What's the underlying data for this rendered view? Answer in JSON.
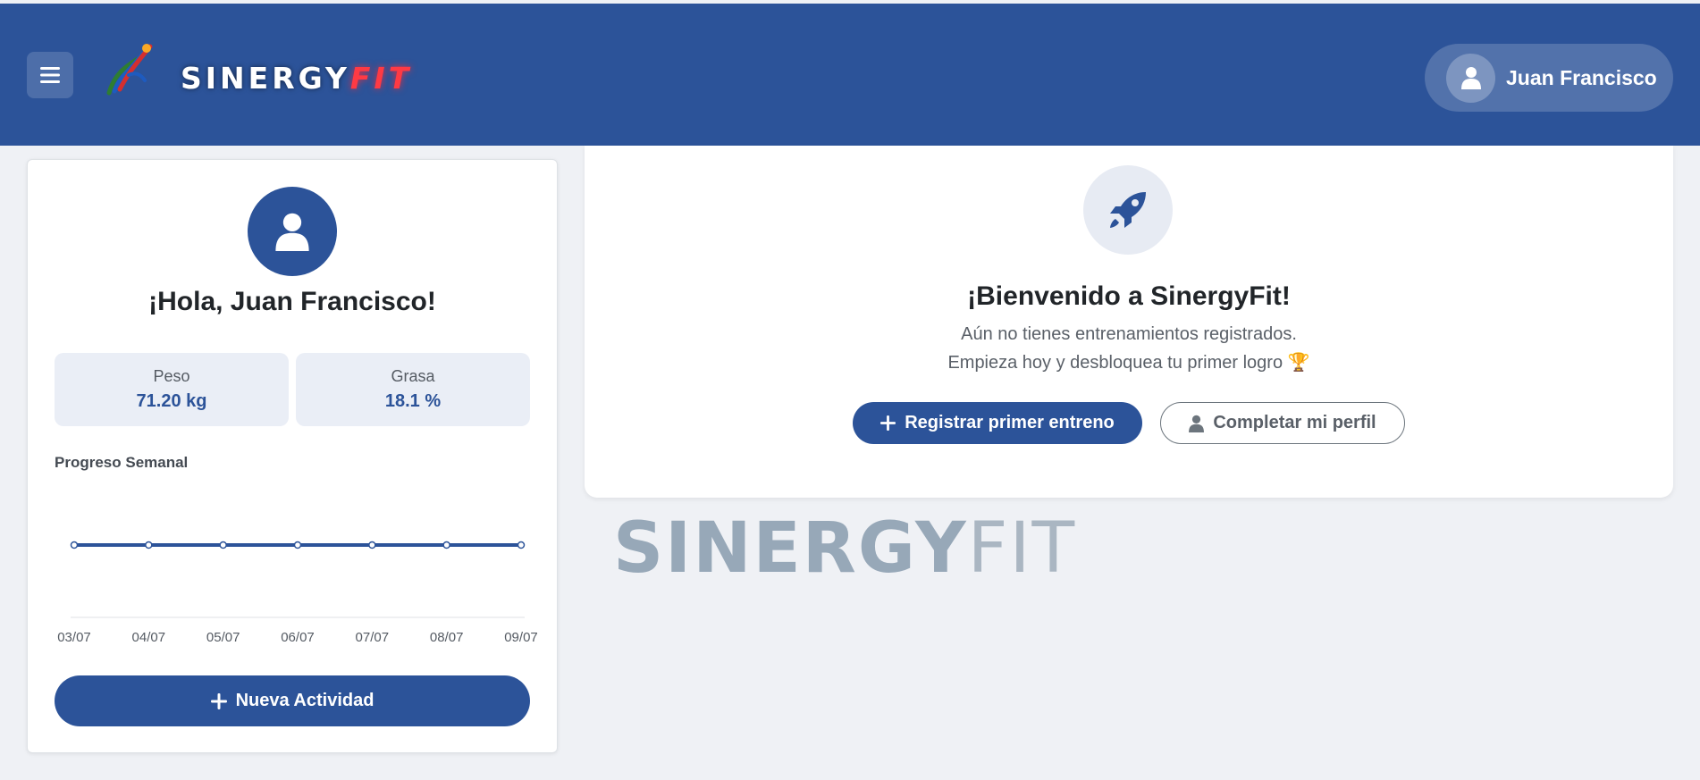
{
  "header": {
    "brand_main": "SINERGY",
    "brand_accent": "FIT",
    "user_name": "Juan Francisco"
  },
  "profile": {
    "greeting": "¡Hola, Juan Francisco!",
    "stats": [
      {
        "label": "Peso",
        "value": "71.20 kg"
      },
      {
        "label": "Grasa",
        "value": "18.1 %"
      }
    ],
    "chart_title": "Progreso Semanal",
    "new_activity_label": "Nueva Actividad"
  },
  "chart_data": {
    "type": "line",
    "title": "Progreso Semanal",
    "categories": [
      "03/07",
      "04/07",
      "05/07",
      "06/07",
      "07/07",
      "08/07",
      "09/07"
    ],
    "series": [
      {
        "values": [
          0,
          0,
          0,
          0,
          0,
          0,
          0
        ]
      }
    ],
    "xlabel": "",
    "ylabel": "",
    "grid": false,
    "colors": [
      "#2c5399"
    ]
  },
  "welcome": {
    "title": "¡Bienvenido a SinergyFit!",
    "line1": "Aún no tienes entrenamientos registrados.",
    "line2": "Empieza hoy y desbloquea tu primer logro 🏆",
    "primary_button": "Registrar primer entreno",
    "secondary_button": "Completar mi perfil"
  },
  "watermark": {
    "main": "SINERGY",
    "accent": "FIT"
  },
  "colors": {
    "brand": "#2c5399",
    "accent": "#ff3a44",
    "background": "#eff1f5"
  }
}
